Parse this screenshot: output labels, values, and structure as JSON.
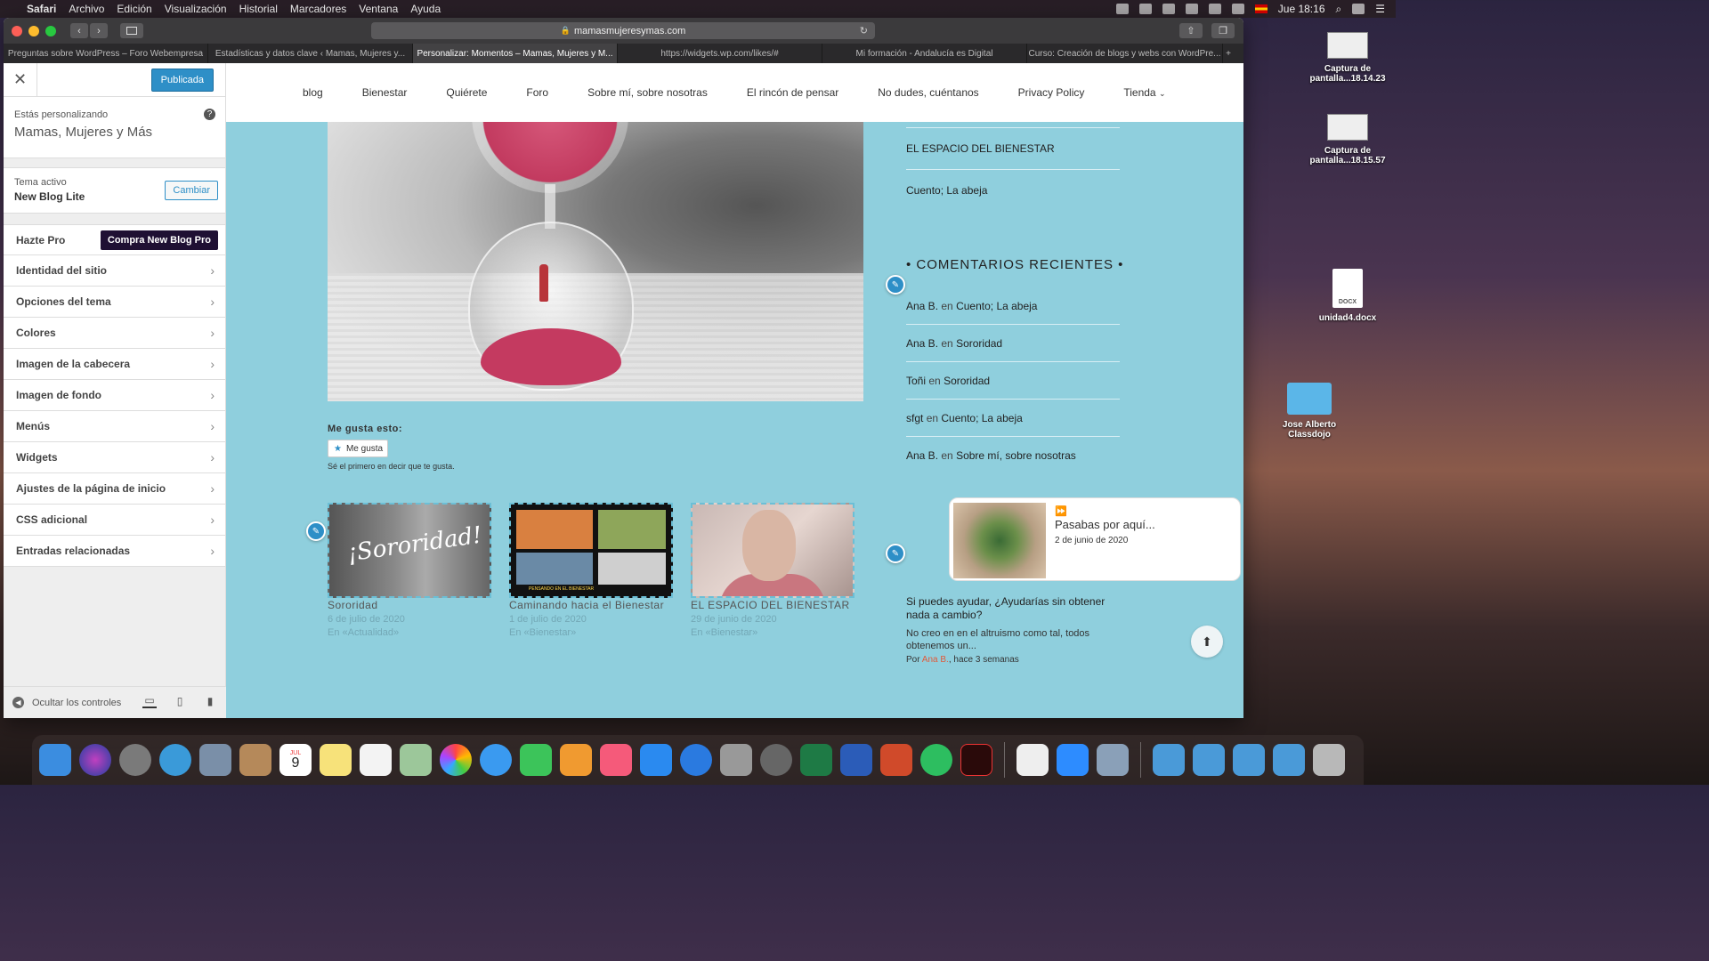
{
  "menubar": {
    "app": "Safari",
    "items": [
      "Archivo",
      "Edición",
      "Visualización",
      "Historial",
      "Marcadores",
      "Ventana",
      "Ayuda"
    ],
    "clock": "Jue 18:16"
  },
  "browser": {
    "url": "mamasmujeresymas.com",
    "tabs": [
      "Preguntas sobre WordPress – Foro Webempresa",
      "Estadísticas y datos clave ‹ Mamas, Mujeres y...",
      "Personalizar: Momentos – Mamas, Mujeres y M...",
      "https://widgets.wp.com/likes/#",
      "Mi formación - Andalucía es Digital",
      "Curso: Creación de blogs y webs con WordPre..."
    ],
    "active_tab_index": 2
  },
  "customizer": {
    "publish_label": "Publicada",
    "customizing_label": "Estás personalizando",
    "site_name": "Mamas, Mujeres y Más",
    "active_theme_label": "Tema activo",
    "theme_name": "New Blog Lite",
    "change_label": "Cambiar",
    "pro_label": "Hazte Pro",
    "pro_button": "Compra New Blog Pro",
    "sections": [
      "Identidad del sitio",
      "Opciones del tema",
      "Colores",
      "Imagen de la cabecera",
      "Imagen de fondo",
      "Menús",
      "Widgets",
      "Ajustes de la página de inicio",
      "CSS adicional",
      "Entradas relacionadas"
    ],
    "hide_controls": "Ocultar los controles"
  },
  "site": {
    "nav": [
      "blog",
      "Bienestar",
      "Quiérete",
      "Foro",
      "Sobre mí, sobre nosotras",
      "El rincón de pensar",
      "No dudes, cuéntanos",
      "Privacy Policy",
      "Tienda"
    ],
    "likes_title": "Me gusta esto:",
    "like_button": "Me gusta",
    "like_note": "Sé el primero en decir que te gusta.",
    "related": [
      {
        "title": "Sororidad",
        "date": "6 de julio de 2020",
        "category": "En «Actualidad»",
        "thumb_text": "¡Sororidad!"
      },
      {
        "title": "Caminando hacia el Bienestar",
        "date": "1 de julio de 2020",
        "category": "En «Bienestar»",
        "thumb_text": "PENSANDO EN EL BIENESTAR"
      },
      {
        "title": "EL ESPACIO DEL BIENESTAR",
        "date": "29 de junio de 2020",
        "category": "En «Bienestar»"
      }
    ],
    "widget_links": [
      "EL ESPACIO DEL BIENESTAR",
      "Cuento; La abeja"
    ],
    "comments_heading": "• COMENTARIOS RECIENTES •",
    "comments": [
      {
        "author": "Ana B.",
        "en": "en",
        "post": "Cuento; La abeja"
      },
      {
        "author": "Ana B.",
        "en": "en",
        "post": "Sororidad"
      },
      {
        "author": "Toñi",
        "en": "en",
        "post": "Sororidad"
      },
      {
        "author": "sfgt",
        "en": "en",
        "post": "Cuento; La abeja"
      },
      {
        "author": "Ana B.",
        "en": "en",
        "post": "Sobre mí, sobre nosotras"
      }
    ],
    "card": {
      "title": "Pasabas por aquí...",
      "date": "2 de junio de 2020"
    },
    "excerpt": {
      "title": "Si puedes ayudar, ¿Ayudarías sin obtener nada a cambio?",
      "body": "No creo en en el altruismo como tal, todos obtenemos un...",
      "by_prefix": "Por",
      "author": "Ana B.",
      "by_suffix": ", hace 3 semanas"
    }
  },
  "desktop": [
    {
      "label": "Captura de pantalla...18.14.23"
    },
    {
      "label": "Captura de pantalla...18.15.57"
    },
    {
      "label": "unidad4.docx"
    },
    {
      "label": "Jose Alberto Classdojo"
    }
  ],
  "dock": {
    "calendar_month": "JUL",
    "calendar_day": "9"
  },
  "colors": {
    "accent": "#2e8fc7",
    "preview_bg": "#8fcfdd",
    "pro_button": "#1f1033",
    "author_link": "#e05a3b"
  }
}
